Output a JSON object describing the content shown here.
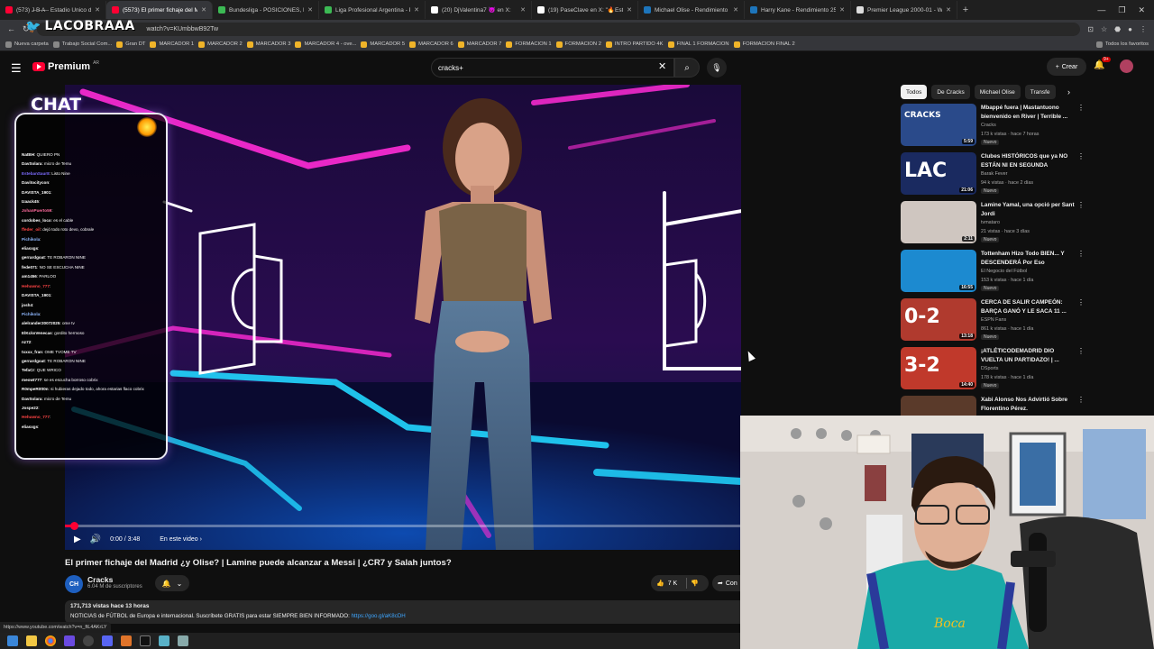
{
  "browser": {
    "tabs": [
      {
        "title": "(573) J̶ B̶ A̶ - Estadio Único de",
        "icon": "youtube-icon",
        "color": "#ff0033"
      },
      {
        "title": "(5573) El primer fichaje del Ma",
        "icon": "youtube-icon",
        "color": "#ff0033",
        "active": true
      },
      {
        "title": "Bundesliga - POSICIONES, RES",
        "icon": "promiedos-icon",
        "color": "#3cba54"
      },
      {
        "title": "Liga Profesional Argentina - P",
        "icon": "promiedos-icon",
        "color": "#3cba54"
      },
      {
        "title": "(20) DjValentina7 😈 en X:",
        "icon": "x-icon",
        "color": "#ffffff"
      },
      {
        "title": "(19) PaseClave en X: \"🔥Est",
        "icon": "x-icon",
        "color": "#ffffff"
      },
      {
        "title": "Michael Olise - Rendimiento 2",
        "icon": "transfermarkt-icon",
        "color": "#1d75bb"
      },
      {
        "title": "Harry Kane - Rendimiento 25/2",
        "icon": "transfermarkt-icon",
        "color": "#1d75bb"
      },
      {
        "title": "Premier League 2000-01 - Wiki",
        "icon": "wikipedia-icon",
        "color": "#dddddd"
      }
    ],
    "url": "watch?v=KUmbbwB92Tw",
    "bookmarks": [
      {
        "label": "Nueva carpeta",
        "folder": true
      },
      {
        "label": "Trabajo Social Com...",
        "folder": true
      },
      {
        "label": "Gran DT",
        "folder": false
      },
      {
        "label": "MARCADOR 1",
        "folder": false
      },
      {
        "label": "MARCADOR 2",
        "folder": false
      },
      {
        "label": "MARCADOR 3",
        "folder": false
      },
      {
        "label": "MARCADOR 4 - ove...",
        "folder": false
      },
      {
        "label": "MARCADOR 5",
        "folder": false
      },
      {
        "label": "MARCADOR 6",
        "folder": false
      },
      {
        "label": "MARCADOR 7",
        "folder": false
      },
      {
        "label": "FORMACION 1",
        "folder": false
      },
      {
        "label": "FORMACION 2",
        "folder": false
      },
      {
        "label": "INTRO PARTIDO 4K",
        "folder": false
      },
      {
        "label": "FINAL 1 FORMACION",
        "folder": false
      },
      {
        "label": "FORMACION FINAL 2",
        "folder": false
      }
    ],
    "all_bookmarks": "Todos los favoritos",
    "status_url": "https://www.youtube.com/watch?v=n_ftL4AKrLY"
  },
  "overlay": {
    "logo_text": "LACOBRAAA",
    "chat_title": "CHAT",
    "chat_lines": [
      {
        "user": "NatBH",
        "msg": ": QUIERO PN",
        "color": "#ffffff"
      },
      {
        "user": "DavSolara",
        "msg": ": micro de Temu",
        "color": "#ffffff"
      },
      {
        "user": "EstebanSaur8",
        "msg": ": Listo Nine",
        "color": "#7d6cff"
      },
      {
        "user": "Davitocitycon",
        "msg": ":",
        "color": "#ffffff"
      },
      {
        "user": "DAVISTA_1901",
        "msg": ":",
        "color": "#ffffff"
      },
      {
        "user": "Izaack45",
        "msg": ":",
        "color": "#ffffff"
      },
      {
        "user": "JohanPuerto59",
        "msg": ":",
        "color": "#ff6b9d"
      },
      {
        "user": "cordobes_loco",
        "msg": ": es el cable",
        "color": "#ffffff"
      },
      {
        "user": "ffeder_oil",
        "msg": ": dejó todo roto devo, cobrale",
        "color": "#ff4444"
      },
      {
        "user": "Pichikola",
        "msg": ":",
        "color": "#8fb8ff"
      },
      {
        "user": "eliasxgs",
        "msg": ":",
        "color": "#ffffff"
      },
      {
        "user": "gerrardgoat",
        "msg": ": TE ROBARON NINE",
        "color": "#ffffff"
      },
      {
        "user": "fede071",
        "msg": ": NO SE ESCUCHA NINE",
        "color": "#ffffff"
      },
      {
        "user": "am1456",
        "msg": ": PARLOO",
        "color": "#ffffff"
      },
      {
        "user": "Hehuwno_777",
        "msg": ":",
        "color": "#ff4444"
      },
      {
        "user": "DAVISTA_1901",
        "msg": ":",
        "color": "#ffffff"
      },
      {
        "user": "josh4",
        "msg": ":",
        "color": "#ffffff"
      },
      {
        "user": "Pichikola",
        "msg": ":",
        "color": "#8fb8ff"
      },
      {
        "user": "alelrander20072025",
        "msg": ": ome tv",
        "color": "#ffffff"
      },
      {
        "user": "ElKcksVenecas",
        "msg": ": gordito hermoso",
        "color": "#ffffff"
      },
      {
        "user": "nz72",
        "msg": ":",
        "color": "#ffffff"
      },
      {
        "user": "txxxx_fran",
        "msg": ": OME TVOME TV",
        "color": "#ffffff"
      },
      {
        "user": "gerrardgoat",
        "msg": ": TE ROBARON NINE",
        "color": "#ffffff"
      },
      {
        "user": "TefaCr",
        "msg": ": QUE WRICO",
        "color": "#ffffff"
      },
      {
        "user": "meowt777",
        "msg": ": se es escucha borroso cobrix",
        "color": "#ffffff"
      },
      {
        "user": "R0mpeR0tt0n",
        "msg": ": si hubieras dejado todo, ahora estarias flaco cobrix",
        "color": "#ffffff"
      },
      {
        "user": "DavSolara",
        "msg": ": micro de Temu",
        "color": "#ffffff"
      },
      {
        "user": "Jospe22",
        "msg": ":",
        "color": "#ffffff"
      },
      {
        "user": "Hehuwno_777",
        "msg": ":",
        "color": "#ff4444"
      },
      {
        "user": "eliasxgs",
        "msg": ":",
        "color": "#ffffff"
      }
    ]
  },
  "youtube": {
    "brand": "Premium",
    "country": "AR",
    "search_value": "cracks+",
    "create_label": "Crear",
    "notif_count": "9+"
  },
  "player": {
    "time": "0:00 / 3:48",
    "in_this_video": "En este video",
    "progress": 0.01
  },
  "video": {
    "title": "El primer fichaje del Madrid ¿y Olise? | Lamine puede alcanzar a Messi | ¿CR7 y Salah juntos?",
    "channel": "Cracks",
    "subs": "6.04 M de suscriptores",
    "likes": "7 K",
    "share_label": "Con",
    "views_time": "171,713 vistas  hace 13 horas",
    "desc_text": "NOTICIAS de FÚTBOL de Europa e internacional. Suscríbete GRATIS para estar SIEMPRE BIEN INFORMADO:",
    "desc_link": "https://goo.gl/aK8cDH",
    "channel_avatar_text": "CH"
  },
  "chips": [
    "Todos",
    "De Cracks",
    "Michael Olise",
    "Transfe"
  ],
  "recommendations": [
    {
      "title": "Mbappé fuera | Mastantuono bienvenido en River | Terrible ...",
      "channel": "Cracks",
      "meta": "173 k vistas · hace 7 horas",
      "badge": "Nuevo",
      "duration": "5:59",
      "bg": "#2a4a8a",
      "thumb_text": "CRACKS"
    },
    {
      "title": "Clubes HISTÓRICOS que ya NO ESTÁN NI EN SEGUNDA",
      "channel": "Barak Fever",
      "meta": "94 k vistas · hace 2 días",
      "badge": "Nuevo",
      "duration": "21:06",
      "bg": "#1a2a60",
      "thumb_text": "LAC"
    },
    {
      "title": "Lamine Yamal, una opció per Sant Jordi",
      "channel": "tvmataro",
      "meta": "21 vistas · hace 3 días",
      "badge": "Nuevo",
      "duration": "2:11",
      "bg": "#cfc6c0",
      "thumb_text": ""
    },
    {
      "title": "Tottenham Hizo Todo BIEN... Y DESCENDERÁ Por Eso",
      "channel": "El Negocio del Fútbol",
      "meta": "153 k vistas · hace 1 día",
      "badge": "Nuevo",
      "duration": "16:55",
      "bg": "#1c8ad0",
      "thumb_text": ""
    },
    {
      "title": "CERCA DE SALIR CAMPEÓN: BARÇA GANÓ Y LE SACA 11 ...",
      "channel": "ESPN Fans",
      "meta": "861 k vistas · hace 1 día",
      "badge": "Nuevo",
      "duration": "13:18",
      "bg": "#b03a2e",
      "thumb_text": "0-2"
    },
    {
      "title": "¡ATLÉTICODEMADRID DIO VUELTA UN PARTIDAZO! | ...",
      "channel": "DSports",
      "meta": "178 k vistas · hace 1 día",
      "badge": "Nuevo",
      "duration": "14:40",
      "bg": "#c0392b",
      "thumb_text": "3-2"
    },
    {
      "title": "Xabi Alonso Nos Advirtió Sobre Florentino Pérez.",
      "channel": "",
      "meta": "",
      "badge": "",
      "duration": "",
      "bg": "#5a3a2a",
      "thumb_text": ""
    }
  ],
  "webcam": {
    "jersey_text": "Boca",
    "jersey_color": "#1aa9a8"
  },
  "colors": {
    "accent_red": "#ff0033",
    "link_blue": "#3ea6ff",
    "neon_pink": "#ff2bd6",
    "neon_cyan": "#21d6ff"
  }
}
